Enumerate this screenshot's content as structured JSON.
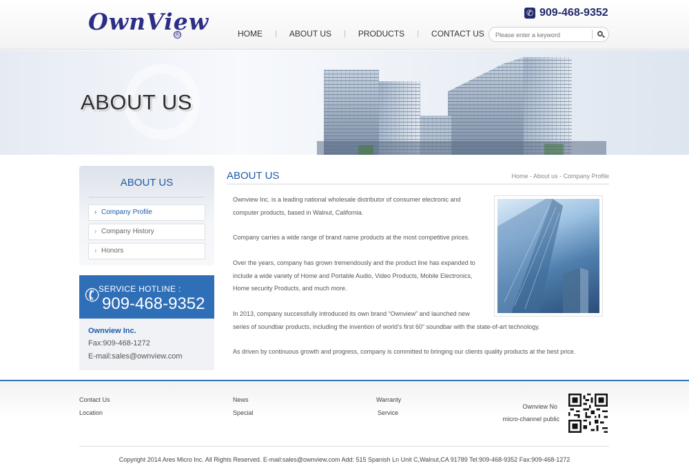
{
  "header": {
    "logo_text": "OwnView",
    "logo_registered": "®",
    "phone": "909-468-9352",
    "nav": [
      "HOME",
      "ABOUT US",
      "PRODUCTS",
      "CONTACT US"
    ],
    "search_placeholder": "Please enter a keyword"
  },
  "banner": {
    "title": "ABOUT US"
  },
  "sidebar": {
    "title": "ABOUT US",
    "items": [
      {
        "label": "Company Profile",
        "active": true
      },
      {
        "label": "Company History",
        "active": false
      },
      {
        "label": "Honors",
        "active": false
      }
    ],
    "hotline_label": "SERVICE HOTLINE :",
    "hotline_number": "909-468-9352",
    "company_name": "Ownview Inc.",
    "fax": "Fax:909-468-1272",
    "email": "E-mail:sales@ownview.com"
  },
  "main": {
    "title": "ABOUT US",
    "breadcrumb": "Home - About us - Company Profile",
    "paragraphs": [
      [
        "Ownview Inc. is a leading national wholesale distributor of consumer electronic and",
        "computer products, based in Walnut, California."
      ],
      [
        "Company carries a wide range of brand name products at the most competitive prices."
      ],
      [
        "Over the years, company has grown tremendously and the product line has expanded to",
        "include a wide variety of Home and Portable Audio, Video Products, Mobile Electronics,",
        "Home security Products, and much more."
      ],
      [
        "In 2013, company successfully introduced its own brand “Ownview” and launched new",
        "series of soundbar products, including the invention of world’s first 60” soundbar with the state-of-art technology."
      ],
      [
        "As driven by continuous growth and progress, company is committed to bringing our clients quality products at the best price."
      ]
    ]
  },
  "footer": {
    "links": {
      "contact_us": "Contact Us",
      "location": "Location",
      "news": "News",
      "special": "Special",
      "warranty": "Warranty",
      "service": "Service"
    },
    "wechat_line1": "Ownview No",
    "wechat_line2": "micro-channel public",
    "copyright": "Copyright 2014 Ares Micro Inc. All Rights Reserved.    E-mail:sales@ownview.com   Add: 515 Spanish Ln Unit C,Walnut,CA 91789  Tel:909-468-9352  Fax:909-468-1272"
  },
  "colors": {
    "brand_blue": "#1e5ca8",
    "hotline_blue": "#2f6fb7",
    "logo_navy": "#2b2e86"
  }
}
